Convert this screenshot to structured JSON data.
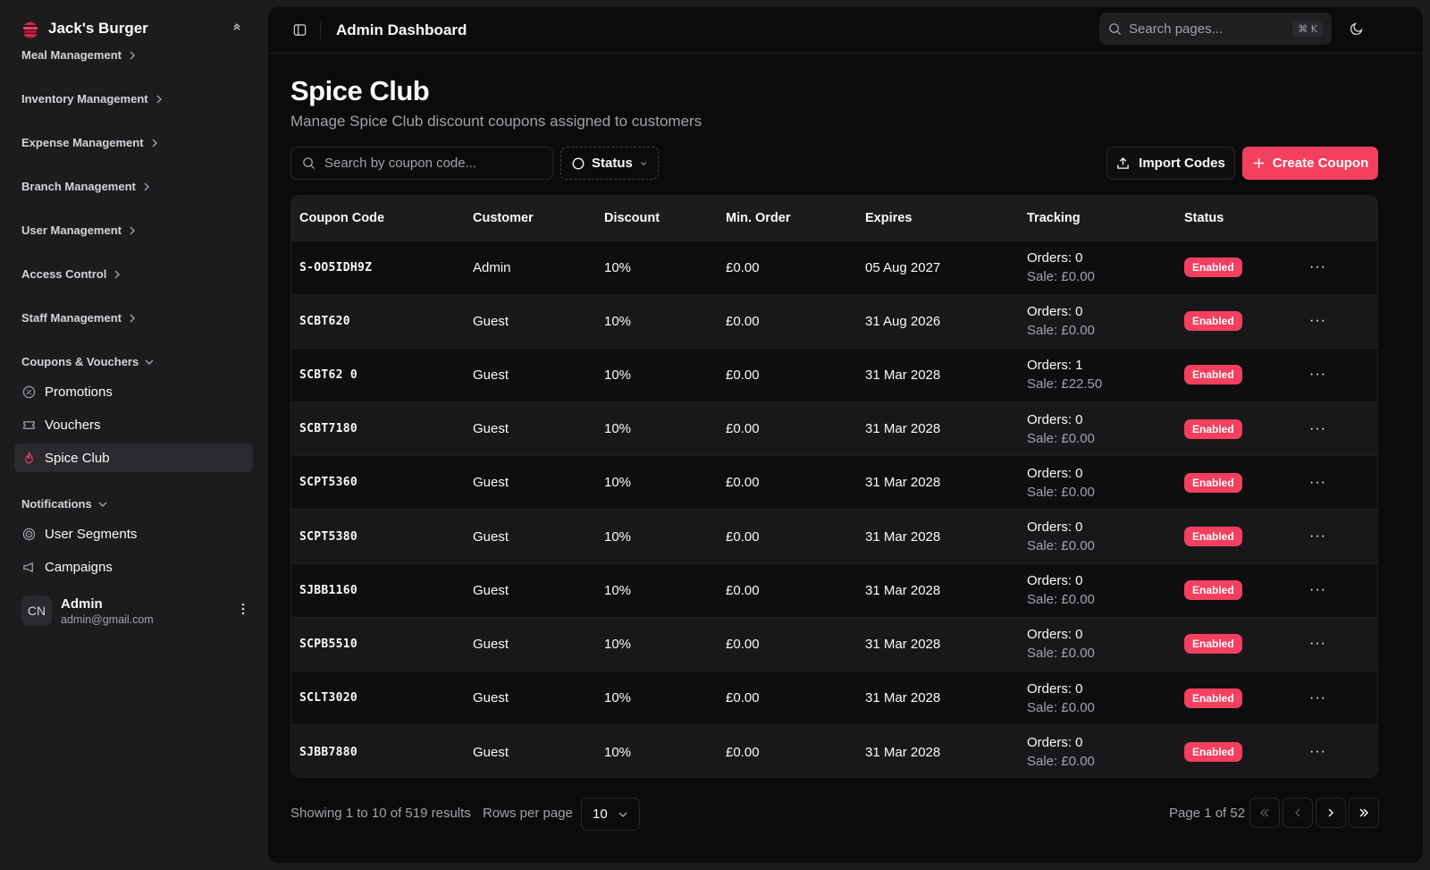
{
  "brand": {
    "name": "Jack's Burger"
  },
  "sidebar": {
    "groups": [
      {
        "label": "Meal Management"
      },
      {
        "label": "Inventory Management"
      },
      {
        "label": "Expense Management"
      },
      {
        "label": "Branch Management"
      },
      {
        "label": "User Management"
      },
      {
        "label": "Access Control"
      },
      {
        "label": "Staff Management"
      },
      {
        "label": "Coupons & Vouchers"
      },
      {
        "label": "Notifications"
      }
    ],
    "items": [
      {
        "label": "Promotions",
        "icon": "badge-percent-icon"
      },
      {
        "label": "Vouchers",
        "icon": "ticket-icon"
      },
      {
        "label": "Spice Club",
        "icon": "flame-icon",
        "active": true
      },
      {
        "label": "User Segments",
        "icon": "target-icon"
      },
      {
        "label": "Campaigns",
        "icon": "megaphone-icon"
      }
    ],
    "user": {
      "initials": "CN",
      "name": "Admin",
      "email": "admin@gmail.com"
    }
  },
  "header": {
    "title": "Admin Dashboard",
    "search_placeholder": "Search pages...",
    "shortcut": "⌘ K"
  },
  "page": {
    "title": "Spice Club",
    "subtitle": "Manage Spice Club discount coupons assigned to customers",
    "search_placeholder": "Search by coupon code...",
    "status_filter_label": "Status",
    "import_label": "Import Codes",
    "create_label": "Create Coupon"
  },
  "table": {
    "columns": [
      "Coupon Code",
      "Customer",
      "Discount",
      "Min. Order",
      "Expires",
      "Tracking",
      "Status"
    ],
    "rows": [
      {
        "code": "S-OO5IDH9Z",
        "customer": "Admin",
        "discount": "10%",
        "min_order": "£0.00",
        "expires": "05 Aug 2027",
        "orders": "Orders: 0",
        "sale": "Sale: £0.00",
        "status": "Enabled"
      },
      {
        "code": "SCBT620",
        "customer": "Guest",
        "discount": "10%",
        "min_order": "£0.00",
        "expires": "31 Aug 2026",
        "orders": "Orders: 0",
        "sale": "Sale: £0.00",
        "status": "Enabled"
      },
      {
        "code": "SCBT62 0",
        "customer": "Guest",
        "discount": "10%",
        "min_order": "£0.00",
        "expires": "31 Mar 2028",
        "orders": "Orders: 1",
        "sale": "Sale: £22.50",
        "status": "Enabled"
      },
      {
        "code": "SCBT7180",
        "customer": "Guest",
        "discount": "10%",
        "min_order": "£0.00",
        "expires": "31 Mar 2028",
        "orders": "Orders: 0",
        "sale": "Sale: £0.00",
        "status": "Enabled"
      },
      {
        "code": "SCPT5360",
        "customer": "Guest",
        "discount": "10%",
        "min_order": "£0.00",
        "expires": "31 Mar 2028",
        "orders": "Orders: 0",
        "sale": "Sale: £0.00",
        "status": "Enabled"
      },
      {
        "code": "SCPT5380",
        "customer": "Guest",
        "discount": "10%",
        "min_order": "£0.00",
        "expires": "31 Mar 2028",
        "orders": "Orders: 0",
        "sale": "Sale: £0.00",
        "status": "Enabled"
      },
      {
        "code": "SJBB1160",
        "customer": "Guest",
        "discount": "10%",
        "min_order": "£0.00",
        "expires": "31 Mar 2028",
        "orders": "Orders: 0",
        "sale": "Sale: £0.00",
        "status": "Enabled"
      },
      {
        "code": "SCPB5510",
        "customer": "Guest",
        "discount": "10%",
        "min_order": "£0.00",
        "expires": "31 Mar 2028",
        "orders": "Orders: 0",
        "sale": "Sale: £0.00",
        "status": "Enabled"
      },
      {
        "code": "SCLT3020",
        "customer": "Guest",
        "discount": "10%",
        "min_order": "£0.00",
        "expires": "31 Mar 2028",
        "orders": "Orders: 0",
        "sale": "Sale: £0.00",
        "status": "Enabled"
      },
      {
        "code": "SJBB7880",
        "customer": "Guest",
        "discount": "10%",
        "min_order": "£0.00",
        "expires": "31 Mar 2028",
        "orders": "Orders: 0",
        "sale": "Sale: £0.00",
        "status": "Enabled"
      }
    ]
  },
  "pagination": {
    "showing": "Showing 1 to 10 of 519 results",
    "rows_per_page_label": "Rows per page",
    "rows_per_page_value": "10",
    "page_info": "Page 1 of 52"
  },
  "colors": {
    "accent": "#f43f5e",
    "background": "#0b0b0c",
    "sidebar": "#1c1c1f"
  }
}
